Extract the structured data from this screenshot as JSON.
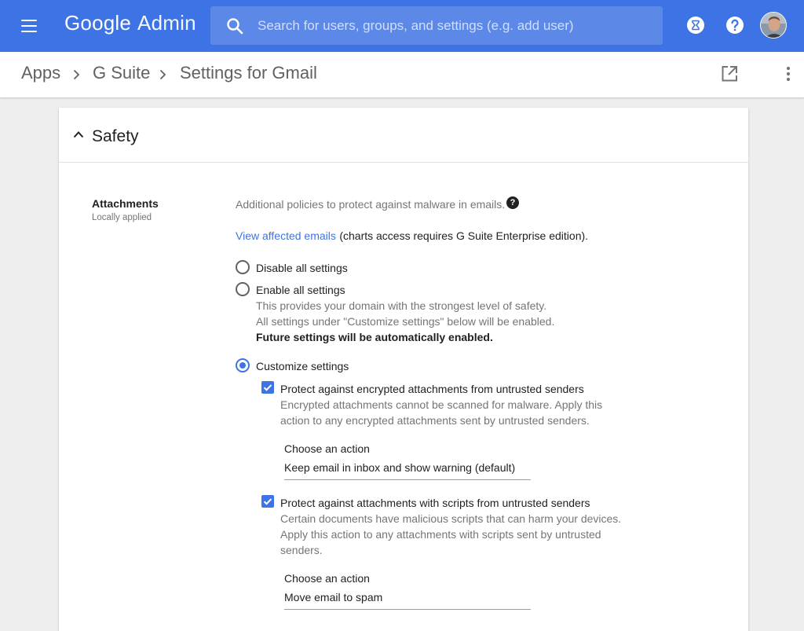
{
  "app": {
    "brand": "Google",
    "product": "Admin"
  },
  "search": {
    "placeholder": "Search for users, groups, and settings (e.g. add user)"
  },
  "breadcrumb": [
    "Apps",
    "G Suite",
    "Settings for Gmail"
  ],
  "section": {
    "title": "Safety",
    "setting": {
      "label": "Attachments",
      "sublabel": "Locally applied",
      "description": "Additional policies to protect against malware in emails.",
      "help_symbol": "?",
      "link_text": "View affected emails",
      "link_note": "(charts access requires G Suite Enterprise edition).",
      "options": [
        {
          "label": "Disable all settings",
          "selected": false
        },
        {
          "label": "Enable all settings",
          "selected": false,
          "desc1": "This provides your domain with the strongest level of safety.",
          "desc2": "All settings under \"Customize settings\" below will be enabled.",
          "desc3": "Future settings will be automatically enabled."
        },
        {
          "label": "Customize settings",
          "selected": true
        }
      ],
      "sub_settings": [
        {
          "label": "Protect against encrypted attachments from untrusted senders",
          "checked": true,
          "desc": [
            "Encrypted attachments cannot be scanned for malware. Apply this",
            "action to any encrypted attachments sent by untrusted senders."
          ],
          "action_label": "Choose an action",
          "action_value": "Keep email in inbox and show warning (default)"
        },
        {
          "label": "Protect against attachments with scripts from untrusted senders",
          "checked": true,
          "desc": [
            "Certain documents have malicious scripts that can harm your devices.",
            "Apply this action to any attachments with scripts sent by untrusted",
            "senders."
          ],
          "action_label": "Choose an action",
          "action_value": "Move email to spam"
        }
      ]
    }
  },
  "colors": {
    "appbar": "#3d73e4",
    "accent": "#3d73e4",
    "background": "#eeeeee"
  }
}
